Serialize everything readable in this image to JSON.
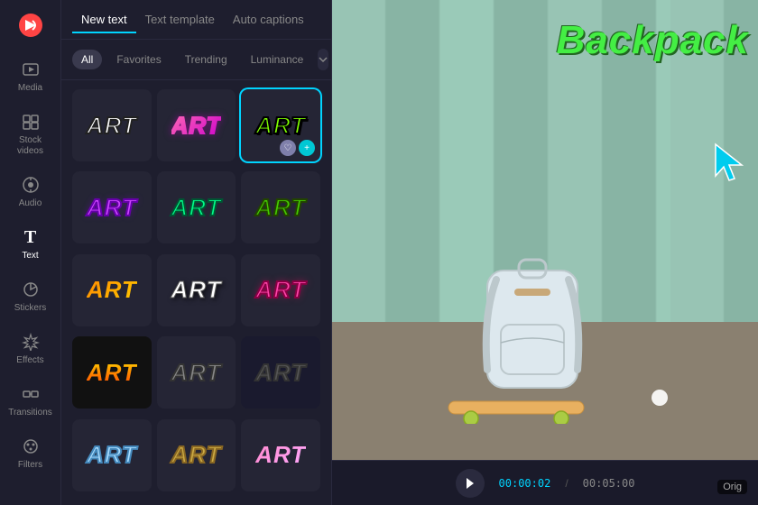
{
  "sidebar": {
    "logo": "✂",
    "items": [
      {
        "id": "media",
        "label": "Media",
        "icon": "⬡"
      },
      {
        "id": "stock-videos",
        "label": "Stock\nvideos",
        "icon": "▦"
      },
      {
        "id": "audio",
        "label": "Audio",
        "icon": "◎"
      },
      {
        "id": "text",
        "label": "Text",
        "icon": "T",
        "active": true
      },
      {
        "id": "stickers",
        "label": "Stickers",
        "icon": "◷"
      },
      {
        "id": "effects",
        "label": "Effects",
        "icon": "✦"
      },
      {
        "id": "transitions",
        "label": "Transitions",
        "icon": "⟺"
      },
      {
        "id": "filters",
        "label": "Filters",
        "icon": "◎"
      }
    ]
  },
  "tabs": [
    {
      "id": "new-text",
      "label": "New text",
      "active": true
    },
    {
      "id": "text-template",
      "label": "Text template"
    },
    {
      "id": "auto-captions",
      "label": "Auto captions"
    }
  ],
  "filters": [
    {
      "id": "all",
      "label": "All",
      "active": true
    },
    {
      "id": "favorites",
      "label": "Favorites"
    },
    {
      "id": "trending",
      "label": "Trending"
    },
    {
      "id": "luminance",
      "label": "Luminance"
    }
  ],
  "cards": [
    {
      "id": 1,
      "text": "ART",
      "style": "art-1"
    },
    {
      "id": 2,
      "text": "ART",
      "style": "art-2"
    },
    {
      "id": 3,
      "text": "ART",
      "style": "art-3",
      "active": true
    },
    {
      "id": 4,
      "text": "ART",
      "style": "art-4"
    },
    {
      "id": 5,
      "text": "ART",
      "style": "art-5"
    },
    {
      "id": 6,
      "text": "ART",
      "style": "art-6"
    },
    {
      "id": 7,
      "text": "ART",
      "style": "art-7"
    },
    {
      "id": 8,
      "text": "ART",
      "style": "art-8"
    },
    {
      "id": 9,
      "text": "ART",
      "style": "art-9"
    },
    {
      "id": 10,
      "text": "ART",
      "style": "art-10"
    },
    {
      "id": 11,
      "text": "ART",
      "style": "art-11"
    },
    {
      "id": 12,
      "text": "ART",
      "style": "art-12"
    }
  ],
  "preview": {
    "backpack_text": "Backpack",
    "orig_label": "Orig",
    "timeline": {
      "current_time": "00:00:02",
      "total_time": "00:05:00"
    }
  }
}
